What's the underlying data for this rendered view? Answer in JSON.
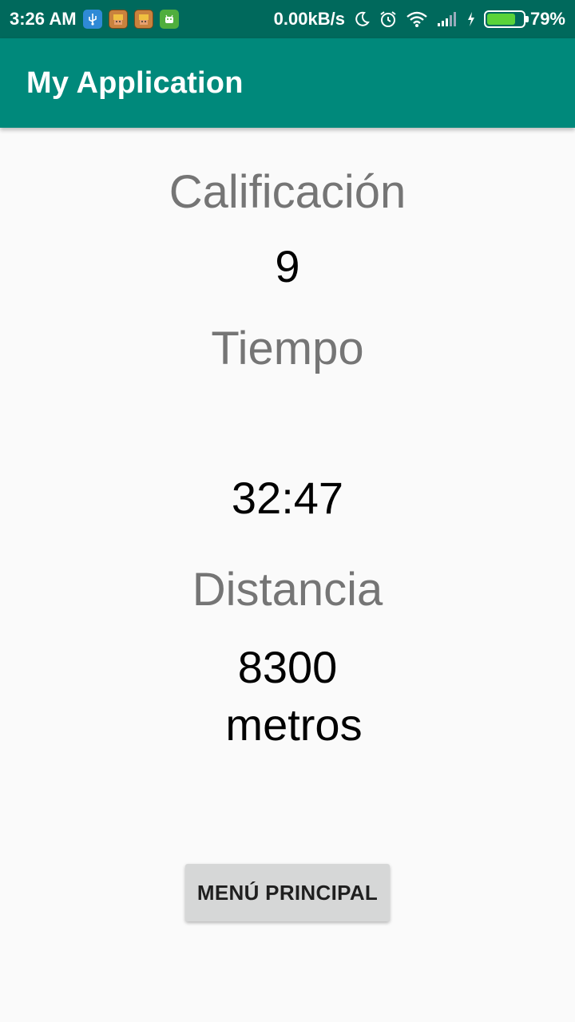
{
  "status_bar": {
    "time": "3:26 AM",
    "net_speed": "0.00kB/s",
    "battery_percent_label": "79%",
    "battery_level": 0.79,
    "battery_color": "#5ad33a",
    "notification_icons": [
      "usb-icon",
      "game-icon",
      "game-icon",
      "android-icon"
    ],
    "system_icons": [
      "moon-icon",
      "alarm-icon",
      "wifi-icon",
      "signal-icon",
      "charging-icon",
      "battery-icon"
    ]
  },
  "app_bar": {
    "title": "My Application",
    "color": "#00897b"
  },
  "results": {
    "score_label": "Calificación",
    "score_value": "9",
    "time_label": "Tiempo",
    "time_value": "32:47",
    "distance_label": "Distancia",
    "distance_value": "8300",
    "distance_unit": "metros"
  },
  "actions": {
    "main_menu_label": "MENÚ PRINCIPAL"
  }
}
